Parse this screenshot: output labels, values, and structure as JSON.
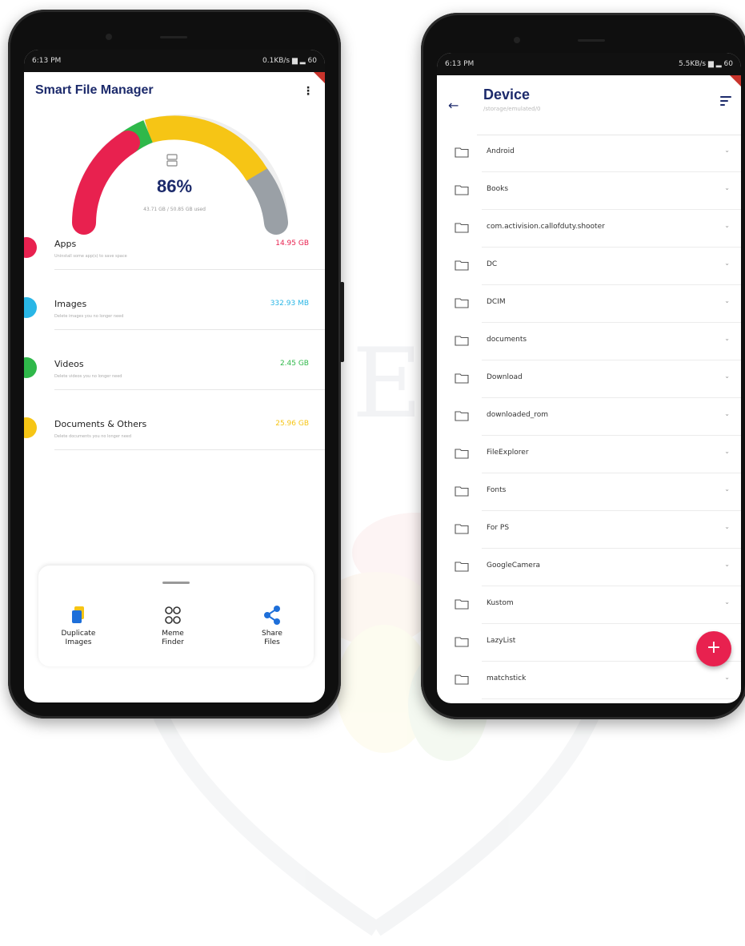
{
  "phone1": {
    "status": {
      "time": "6:13 PM",
      "right": "0.1KB/s ▆ ▂ 60"
    },
    "app_title": "Smart File Manager",
    "gauge": {
      "percent": "86%",
      "used_text": "43.71 GB / 50.85 GB used",
      "fill_fraction": 0.86
    },
    "categories": [
      {
        "name": "Apps",
        "desc": "Uninstall some app(s) to save space",
        "size": "14.95 GB",
        "color": "#e8214f"
      },
      {
        "name": "Images",
        "desc": "Delete images you no longer need",
        "size": "332.93 MB",
        "color": "#29b6e6"
      },
      {
        "name": "Videos",
        "desc": "Delete videos you no longer need",
        "size": "2.45 GB",
        "color": "#2fb84a"
      },
      {
        "name": "Documents & Others",
        "desc": "Delete documents you no longer need",
        "size": "25.96 GB",
        "color": "#f6c515"
      }
    ],
    "tools": [
      {
        "label1": "Duplicate",
        "label2": "Images",
        "icon": "duplicate-images-icon"
      },
      {
        "label1": "Meme",
        "label2": "Finder",
        "icon": "meme-finder-icon"
      },
      {
        "label1": "Share",
        "label2": "Files",
        "icon": "share-icon"
      }
    ]
  },
  "phone2": {
    "status": {
      "time": "6:13 PM",
      "right": "5.5KB/s ▆ ▂ 60"
    },
    "title": "Device",
    "path": "/storage/emulated/0",
    "folders": [
      "Android",
      "Books",
      "com.activision.callofduty.shooter",
      "DC",
      "DCIM",
      "documents",
      "Download",
      "downloaded_rom",
      "FileExplorer",
      "Fonts",
      "For PS",
      "GoogleCamera",
      "Kustom",
      "LazyList",
      "matchstick"
    ],
    "fab_label": "+"
  },
  "colors": {
    "brand": "#1c2a6b",
    "apps": "#e8214f",
    "images": "#29b6e6",
    "videos": "#2fb84a",
    "documents": "#f6c515",
    "free": "#9aa0a6"
  }
}
